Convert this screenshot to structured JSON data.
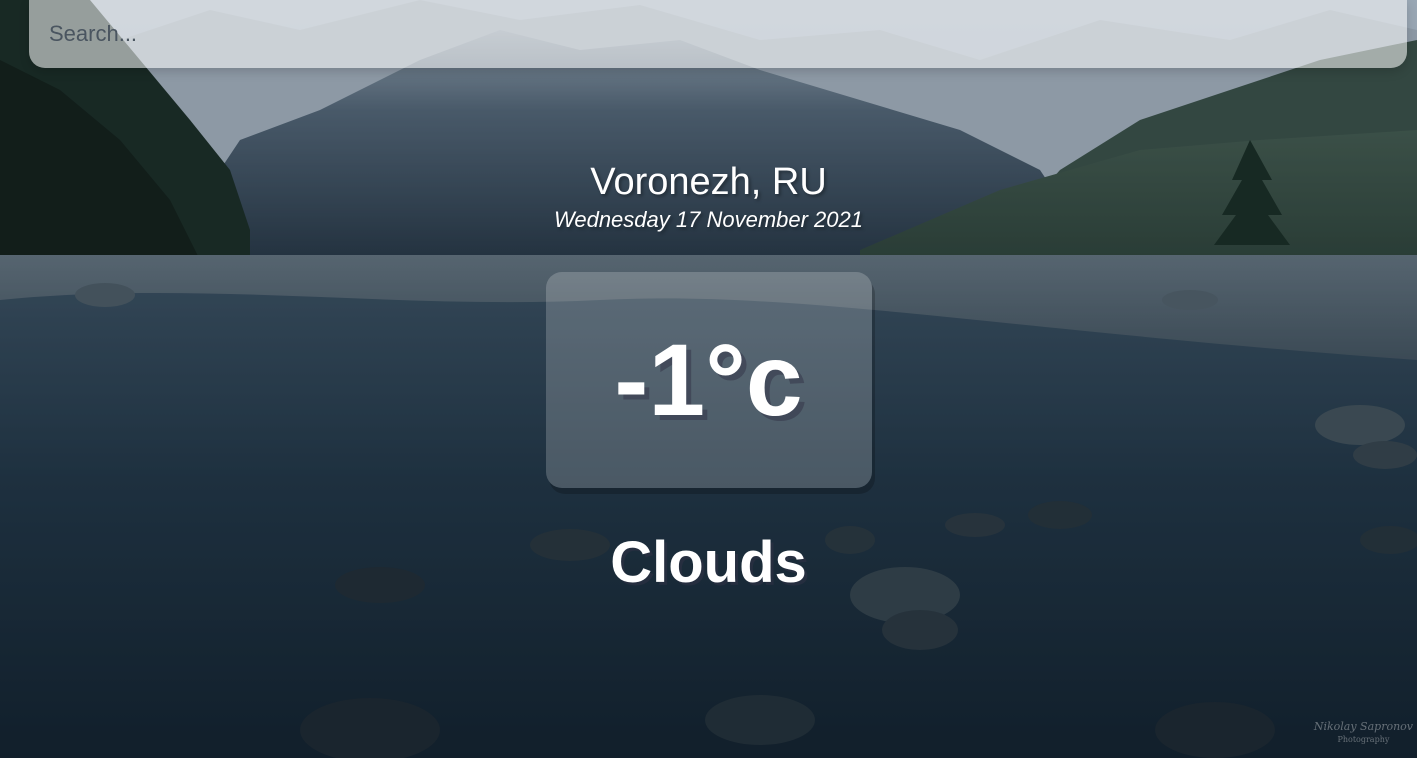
{
  "search": {
    "placeholder": "Search..."
  },
  "location": {
    "city": "Voronezh, RU",
    "date": "Wednesday 17 November 2021"
  },
  "weather": {
    "temperature": "-1°c",
    "condition": "Clouds"
  },
  "background": {
    "scene": "mountain-river-landscape-photo",
    "watermark": "Nikolay Sapronov",
    "watermark_sub": "Photography"
  },
  "colors": {
    "text": "#ffffff",
    "card_background": "rgba(255,255,255,0.2)",
    "search_background": "rgba(255,255,255,0.55)"
  }
}
